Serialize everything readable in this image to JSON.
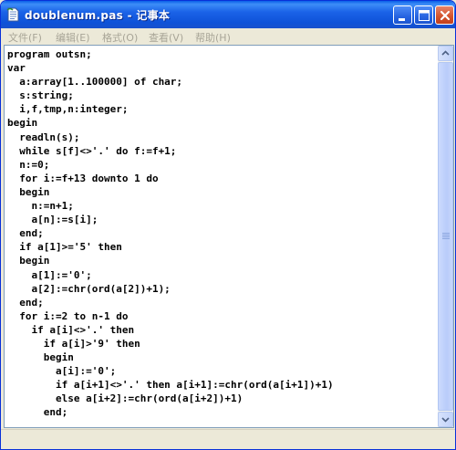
{
  "window": {
    "title": "doublenum.pas - 记事本",
    "icon": "notepad-icon",
    "titlebar_color": "#0A5FE8",
    "controls": [
      "minimize-icon",
      "maximize-icon",
      "close-icon"
    ]
  },
  "menu": {
    "items": [
      {
        "label": "文件(F)"
      },
      {
        "label": "编辑(E)"
      },
      {
        "label": "格式(O)"
      },
      {
        "label": "查看(V)"
      },
      {
        "label": "帮助(H)"
      }
    ]
  },
  "editor": {
    "text": "program outsn;\nvar\n  a:array[1..100000] of char;\n  s:string;\n  i,f,tmp,n:integer;\nbegin\n  readln(s);\n  while s[f]<>'.' do f:=f+1;\n  n:=0;\n  for i:=f+13 downto 1 do\n  begin\n    n:=n+1;\n    a[n]:=s[i];\n  end;\n  if a[1]>='5' then\n  begin\n    a[1]:='0';\n    a[2]:=chr(ord(a[2])+1);\n  end;\n  for i:=2 to n-1 do\n    if a[i]<>'.' then\n      if a[i]>'9' then\n      begin\n        a[i]:='0';\n        if a[i+1]<>'.' then a[i+1]:=chr(ord(a[i+1])+1)\n        else a[i+2]:=chr(ord(a[i+2])+1)\n      end;"
  },
  "scrollbar": {
    "up_icon": "chevron-up-icon",
    "down_icon": "chevron-down-icon"
  }
}
